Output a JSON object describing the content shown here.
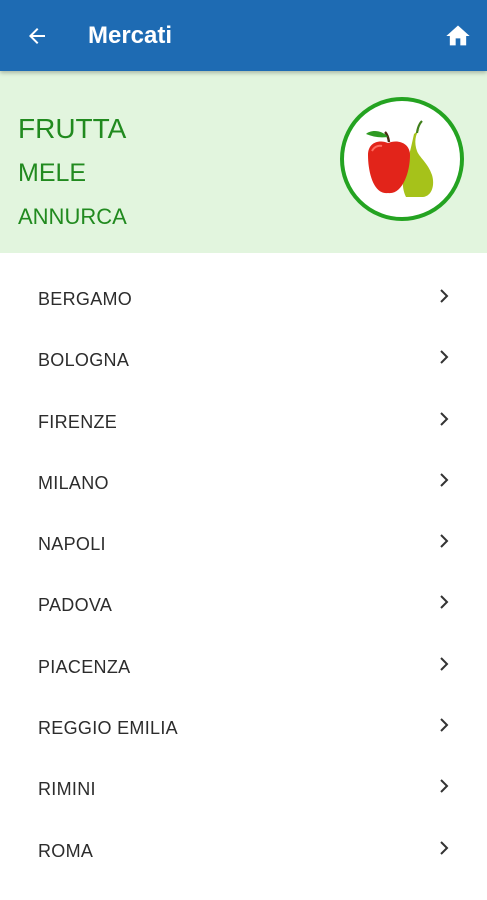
{
  "appbar": {
    "title": "Mercati",
    "back_icon": "arrow-back-icon",
    "home_icon": "home-icon",
    "color": "#1e6bb3"
  },
  "header": {
    "category": "FRUTTA",
    "subcategory": "MELE",
    "variety": "ANNURCA",
    "text_color": "#218a1f",
    "background": "#e2f5de",
    "image_icon": "apple-pear-icon"
  },
  "markets": [
    {
      "label": "BERGAMO"
    },
    {
      "label": "BOLOGNA"
    },
    {
      "label": "FIRENZE"
    },
    {
      "label": "MILANO"
    },
    {
      "label": "NAPOLI"
    },
    {
      "label": "PADOVA"
    },
    {
      "label": "PIACENZA"
    },
    {
      "label": "REGGIO EMILIA"
    },
    {
      "label": "RIMINI"
    },
    {
      "label": "ROMA"
    }
  ],
  "row_icon": "chevron-right-icon"
}
